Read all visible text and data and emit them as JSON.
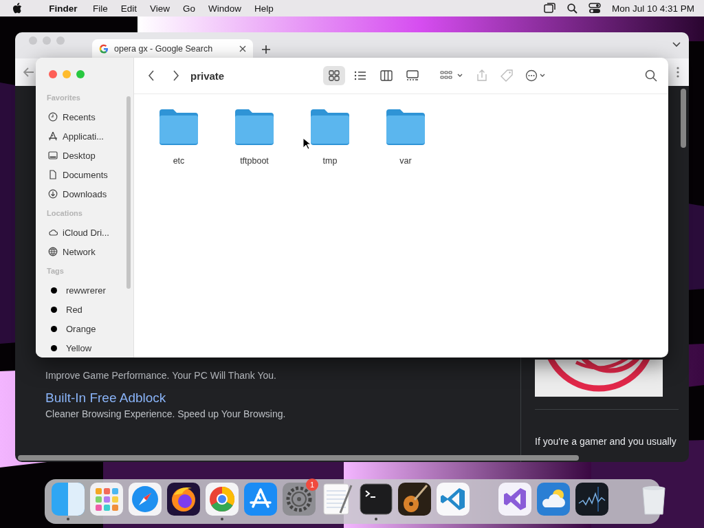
{
  "menu_bar": {
    "app": "Finder",
    "items": [
      "File",
      "Edit",
      "View",
      "Go",
      "Window",
      "Help"
    ],
    "clock": "Mon Jul 10  4:31 PM"
  },
  "browser": {
    "tabs": [
      {
        "title": "opera gx - Google Search",
        "selected": true
      }
    ],
    "results": [
      {
        "kind": "snippet",
        "text": "Improve Game Performance. Your PC Will Thank You."
      },
      {
        "kind": "link",
        "text": "Built-In Free Adblock"
      },
      {
        "kind": "snippet",
        "text": "Cleaner Browsing Experience. Speed up Your Browsing."
      }
    ],
    "side_text": "If you're a gamer and you usually"
  },
  "finder": {
    "title": "private",
    "view_modes": [
      {
        "selected": true
      },
      {
        "selected": false
      },
      {
        "selected": false
      },
      {
        "selected": false
      }
    ],
    "sidebar": [
      {
        "heading": "Favorites",
        "items": [
          {
            "label": "Recents",
            "selected": false
          },
          {
            "label": "Applicati...",
            "selected": false
          },
          {
            "label": "Desktop",
            "selected": false
          },
          {
            "label": "Documents",
            "selected": false
          },
          {
            "label": "Downloads",
            "selected": false
          }
        ]
      },
      {
        "heading": "Locations",
        "items": [
          {
            "label": "iCloud Dri...",
            "selected": false
          },
          {
            "label": "Network",
            "selected": false
          }
        ]
      },
      {
        "heading": "Tags",
        "items": [
          {
            "label": "rewwrerer",
            "selected": false,
            "kind": "tag"
          },
          {
            "label": "Red",
            "selected": false,
            "kind": "tag"
          },
          {
            "label": "Orange",
            "selected": false,
            "kind": "tag"
          },
          {
            "label": "Yellow",
            "selected": false,
            "kind": "tag"
          }
        ]
      }
    ],
    "folders": [
      {
        "name": "etc"
      },
      {
        "name": "tftpboot"
      },
      {
        "name": "tmp"
      },
      {
        "name": "var"
      }
    ]
  },
  "dock": {
    "apps": [
      {
        "running": true
      },
      {
        "running": false
      },
      {
        "running": false
      },
      {
        "running": false
      },
      {
        "running": true
      },
      {
        "running": false
      },
      {
        "running": false,
        "badge": "1"
      },
      {
        "running": false
      },
      {
        "running": true
      },
      {
        "running": false
      },
      {
        "running": false
      },
      {
        "running": false
      },
      {
        "running": false
      },
      {
        "running": false
      },
      {
        "running": false
      }
    ]
  }
}
